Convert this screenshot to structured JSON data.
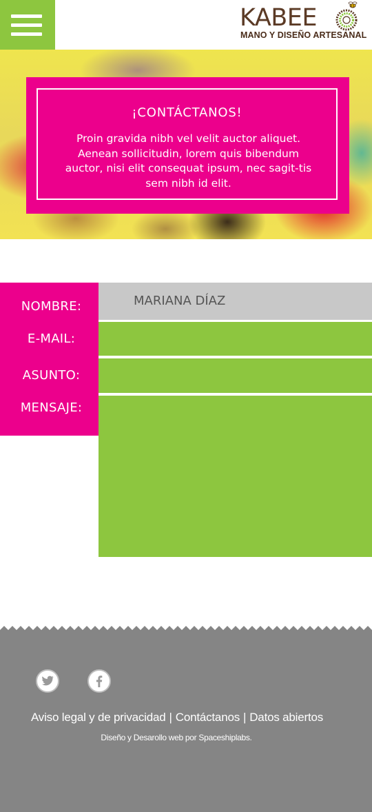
{
  "header": {
    "menu_icon": "hamburger-menu-icon",
    "logo": {
      "wordmark": "KABEE",
      "tagline": "MANO Y DISEÑO ARTESANAL",
      "mark_icon": "basket-bee-logo-icon"
    }
  },
  "hero": {
    "title": "¡CONTÁCTANOS!",
    "text": "Proin gravida nibh vel velit auctor aliquet. Aenean sollicitudin, lorem quis bibendum auctor, nisi elit consequat ipsum, nec sagit-tis sem nibh id elit."
  },
  "form": {
    "labels": {
      "nombre": "NOMBRE:",
      "email": "E-MAIL:",
      "asunto": "ASUNTO:",
      "mensaje": "MENSAJE:"
    },
    "values": {
      "nombre": "MARIANA DÍAZ",
      "email": "",
      "asunto": "",
      "mensaje": ""
    }
  },
  "footer": {
    "social_icons": [
      "twitter-icon",
      "facebook-icon"
    ],
    "links": [
      "Aviso legal y de privacidad",
      "Contáctanos",
      "Datos abiertos"
    ],
    "separator": "|",
    "credit": "Diseño y Desarollo web por Spaceshiplabs."
  },
  "colors": {
    "green": "#8dc63f",
    "magenta": "#ec008c",
    "footer_gray": "#858585",
    "input_gray": "#c8c8c8",
    "logo_brown": "#5b3a25"
  }
}
